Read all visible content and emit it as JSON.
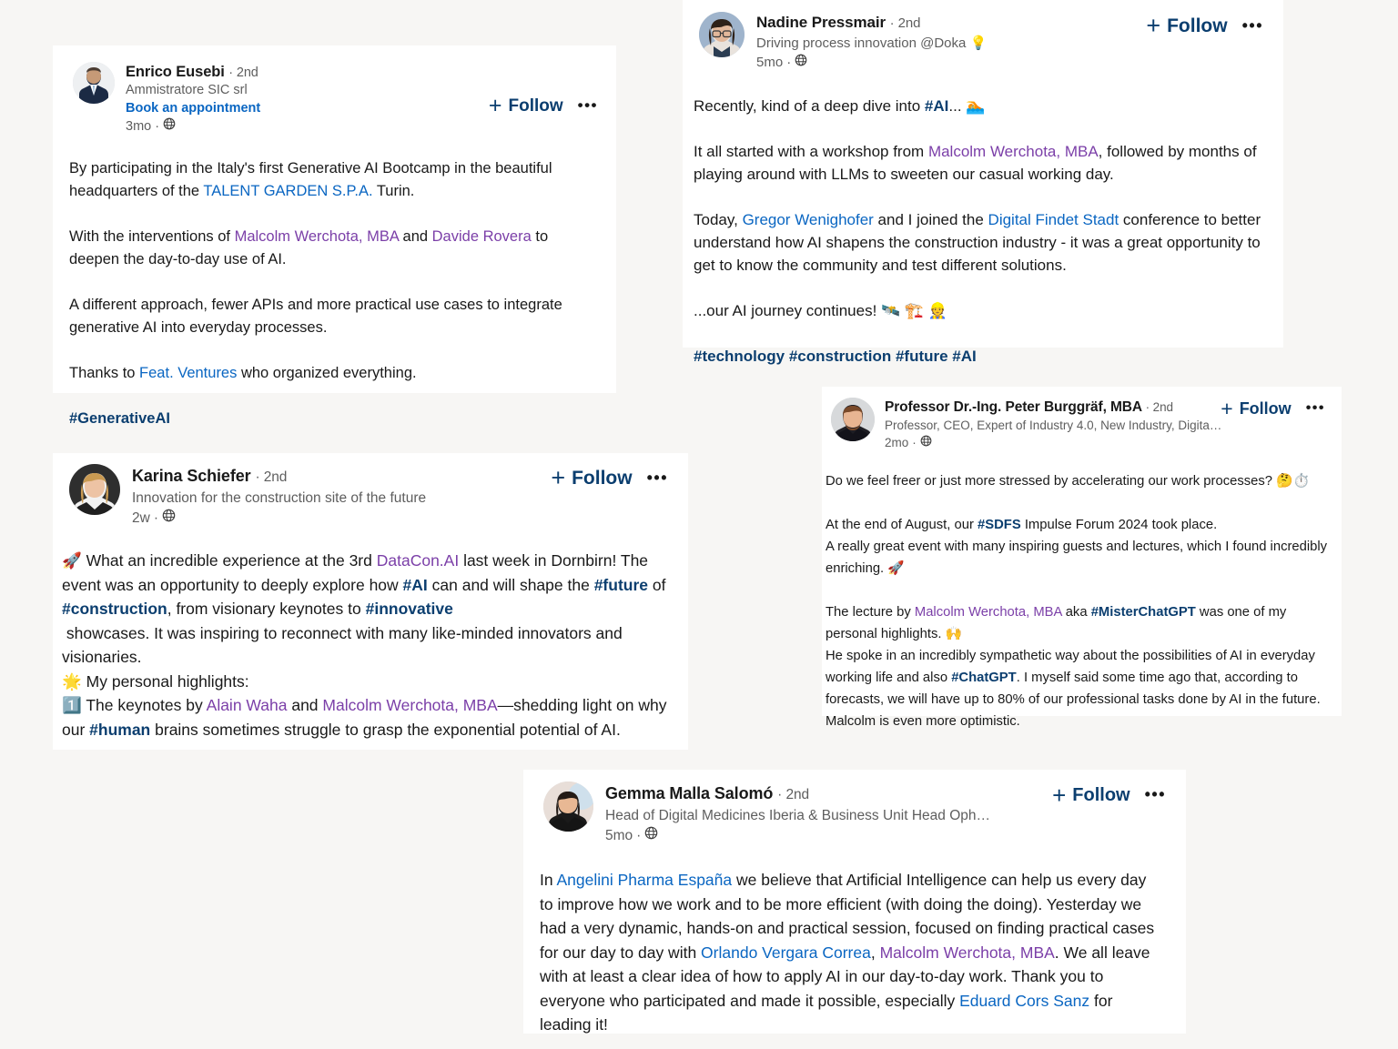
{
  "colors": {
    "page_background": "#f7f6f4",
    "card_background": "#ffffff",
    "text_primary": "#191919",
    "text_secondary": "#5e5e5e",
    "link_blue": "#0a66c2",
    "follow_blue": "#0b3e6f",
    "hashtag_blue": "#0b3e6f",
    "mention_purple": "#7b3fa8"
  },
  "common": {
    "follow_label": "Follow",
    "plus_glyph": "+",
    "more_glyph": "•••",
    "degree": "· 2nd",
    "visibility_icon": "globe-icon"
  },
  "posts": [
    {
      "id": "enrico",
      "author": "Enrico Eusebi",
      "degree": "· 2nd",
      "headline": "Ammistratore SIC srl",
      "cta": "Book an appointment",
      "time": "3mo",
      "separator": "·",
      "follow_label": "Follow",
      "body": [
        [
          {
            "t": "By participating in the Italy's first Generative AI Bootcamp in the beautiful headquarters of the ",
            "k": "plain"
          },
          {
            "t": "TALENT GARDEN S.P.A.",
            "k": "link"
          },
          {
            "t": " Turin.",
            "k": "plain"
          }
        ],
        [],
        [
          {
            "t": "With the interventions of ",
            "k": "plain"
          },
          {
            "t": "Malcolm Werchota, MBA",
            "k": "mention"
          },
          {
            "t": " and ",
            "k": "plain"
          },
          {
            "t": "Davide Rovera",
            "k": "mention"
          },
          {
            "t": " to deepen the day-to-day use of AI.",
            "k": "plain"
          }
        ],
        [],
        [
          {
            "t": "A different approach, fewer APIs and more practical use cases to integrate generative AI into everyday processes.",
            "k": "plain"
          }
        ],
        [],
        [
          {
            "t": "Thanks to ",
            "k": "plain"
          },
          {
            "t": "Feat. Ventures",
            "k": "link"
          },
          {
            "t": " who organized everything.",
            "k": "plain"
          }
        ],
        [],
        [
          {
            "t": "#GenerativeAI",
            "k": "tag"
          }
        ]
      ]
    },
    {
      "id": "nadine",
      "author": "Nadine Pressmair",
      "degree": "· 2nd",
      "headline": "Driving process innovation @Doka 💡",
      "cta": null,
      "time": "5mo",
      "separator": "·",
      "follow_label": "Follow",
      "body": [
        [
          {
            "t": "Recently, kind of a deep dive into ",
            "k": "plain"
          },
          {
            "t": "#AI",
            "k": "tag"
          },
          {
            "t": "... 🏊",
            "k": "plain"
          }
        ],
        [],
        [
          {
            "t": "It all started with a workshop from ",
            "k": "plain"
          },
          {
            "t": "Malcolm Werchota, MBA",
            "k": "mention"
          },
          {
            "t": ", followed by months of playing around with LLMs to sweeten our casual working day.",
            "k": "plain"
          }
        ],
        [],
        [
          {
            "t": "Today, ",
            "k": "plain"
          },
          {
            "t": "Gregor Wenighofer",
            "k": "link"
          },
          {
            "t": " and I joined the ",
            "k": "plain"
          },
          {
            "t": "Digital Findet Stadt",
            "k": "link"
          },
          {
            "t": " conference to better understand how AI shapens the construction industry - it was a great opportunity to get to know the community and test different solutions.",
            "k": "plain"
          }
        ],
        [],
        [
          {
            "t": "...our AI journey continues! 🛰️ 🏗️ 👷",
            "k": "plain"
          }
        ],
        [],
        [
          {
            "t": "#technology #construction #future #AI",
            "k": "tag"
          }
        ]
      ]
    },
    {
      "id": "karina",
      "author": "Karina Schiefer",
      "degree": "· 2nd",
      "headline": "Innovation for the construction site of the future",
      "cta": null,
      "time": "2w",
      "separator": "·",
      "follow_label": "Follow",
      "body": [
        [
          {
            "t": "🚀 What an incredible experience at the 3rd ",
            "k": "plain"
          },
          {
            "t": "DataCon.AI",
            "k": "mention"
          },
          {
            "t": " last week in Dornbirn! The event was an opportunity to deeply explore how ",
            "k": "plain"
          },
          {
            "t": "#AI",
            "k": "tag"
          },
          {
            "t": " can and will shape the ",
            "k": "plain"
          },
          {
            "t": "#future",
            "k": "tag"
          },
          {
            "t": " of ",
            "k": "plain"
          },
          {
            "t": "#construction",
            "k": "tag"
          },
          {
            "t": ", from visionary keynotes to ",
            "k": "plain"
          },
          {
            "t": "#innovative",
            "k": "tag"
          },
          {
            "t": "\n showcases. It was inspiring to reconnect with many like-minded innovators and visionaries.",
            "k": "plain"
          }
        ],
        [
          {
            "t": "🌟 My personal highlights:",
            "k": "plain"
          }
        ],
        [
          {
            "t": "1️⃣ The keynotes by ",
            "k": "plain"
          },
          {
            "t": "Alain Waha",
            "k": "mention"
          },
          {
            "t": " and ",
            "k": "plain"
          },
          {
            "t": "Malcolm Werchota, MBA",
            "k": "mention"
          },
          {
            "t": "—shedding light on why our ",
            "k": "plain"
          },
          {
            "t": "#human",
            "k": "tag"
          },
          {
            "t": " brains sometimes struggle to grasp the exponential potential of AI.",
            "k": "plain"
          }
        ]
      ]
    },
    {
      "id": "burggraf",
      "author": "Professor Dr.-Ing. Peter Burggräf, MBA",
      "degree": "· 2nd",
      "headline": "Professor, CEO, Expert of Industry 4.0, New Industry, Digita…",
      "cta": null,
      "time": "2mo",
      "separator": "·",
      "follow_label": "Follow",
      "body": [
        [
          {
            "t": "Do we feel freer or just more stressed by accelerating our work processes? 🤔⏱️",
            "k": "plain"
          }
        ],
        [],
        [
          {
            "t": "At the end of August, our ",
            "k": "plain"
          },
          {
            "t": "#SDFS",
            "k": "tag"
          },
          {
            "t": " Impulse Forum 2024 took place.\nA really great event with many inspiring guests and lectures, which I found incredibly enriching. 🚀",
            "k": "plain"
          }
        ],
        [],
        [
          {
            "t": "The lecture by ",
            "k": "plain"
          },
          {
            "t": "Malcolm Werchota, MBA",
            "k": "mention"
          },
          {
            "t": " aka ",
            "k": "plain"
          },
          {
            "t": "#MisterChatGPT",
            "k": "tag"
          },
          {
            "t": " was one of my personal highlights. 🙌\nHe spoke in an incredibly sympathetic way about the possibilities of AI in everyday working life and also ",
            "k": "plain"
          },
          {
            "t": "#ChatGPT",
            "k": "tag"
          },
          {
            "t": ". I myself said some time ago that, according to forecasts, we will have up to 80% of our professional tasks done by AI in the future.\nMalcolm is even more optimistic.",
            "k": "plain"
          }
        ]
      ]
    },
    {
      "id": "gemma",
      "author": "Gemma Malla Salomó",
      "degree": "· 2nd",
      "headline": "Head of Digital Medicines Iberia & Business Unit Head Oph…",
      "cta": null,
      "time": "5mo",
      "separator": "·",
      "follow_label": "Follow",
      "body": [
        [
          {
            "t": "In ",
            "k": "plain"
          },
          {
            "t": "Angelini Pharma España",
            "k": "link"
          },
          {
            "t": " we believe that Artificial Intelligence can help us every day to improve how we work and to be more efficient (with doing the doing). Yesterday we had a very dynamic, hands-on and practical session, focused on finding practical cases for our day to day with ",
            "k": "plain"
          },
          {
            "t": "Orlando Vergara Correa",
            "k": "link"
          },
          {
            "t": ", ",
            "k": "plain"
          },
          {
            "t": "Malcolm Werchota, MBA",
            "k": "mention"
          },
          {
            "t": ". We all leave with at least a clear idea of how to apply AI in our day-to-day work. Thank you to everyone who participated and made it possible, especially ",
            "k": "plain"
          },
          {
            "t": "Eduard Cors Sanz",
            "k": "link"
          },
          {
            "t": " for leading it!",
            "k": "plain"
          }
        ]
      ]
    }
  ]
}
